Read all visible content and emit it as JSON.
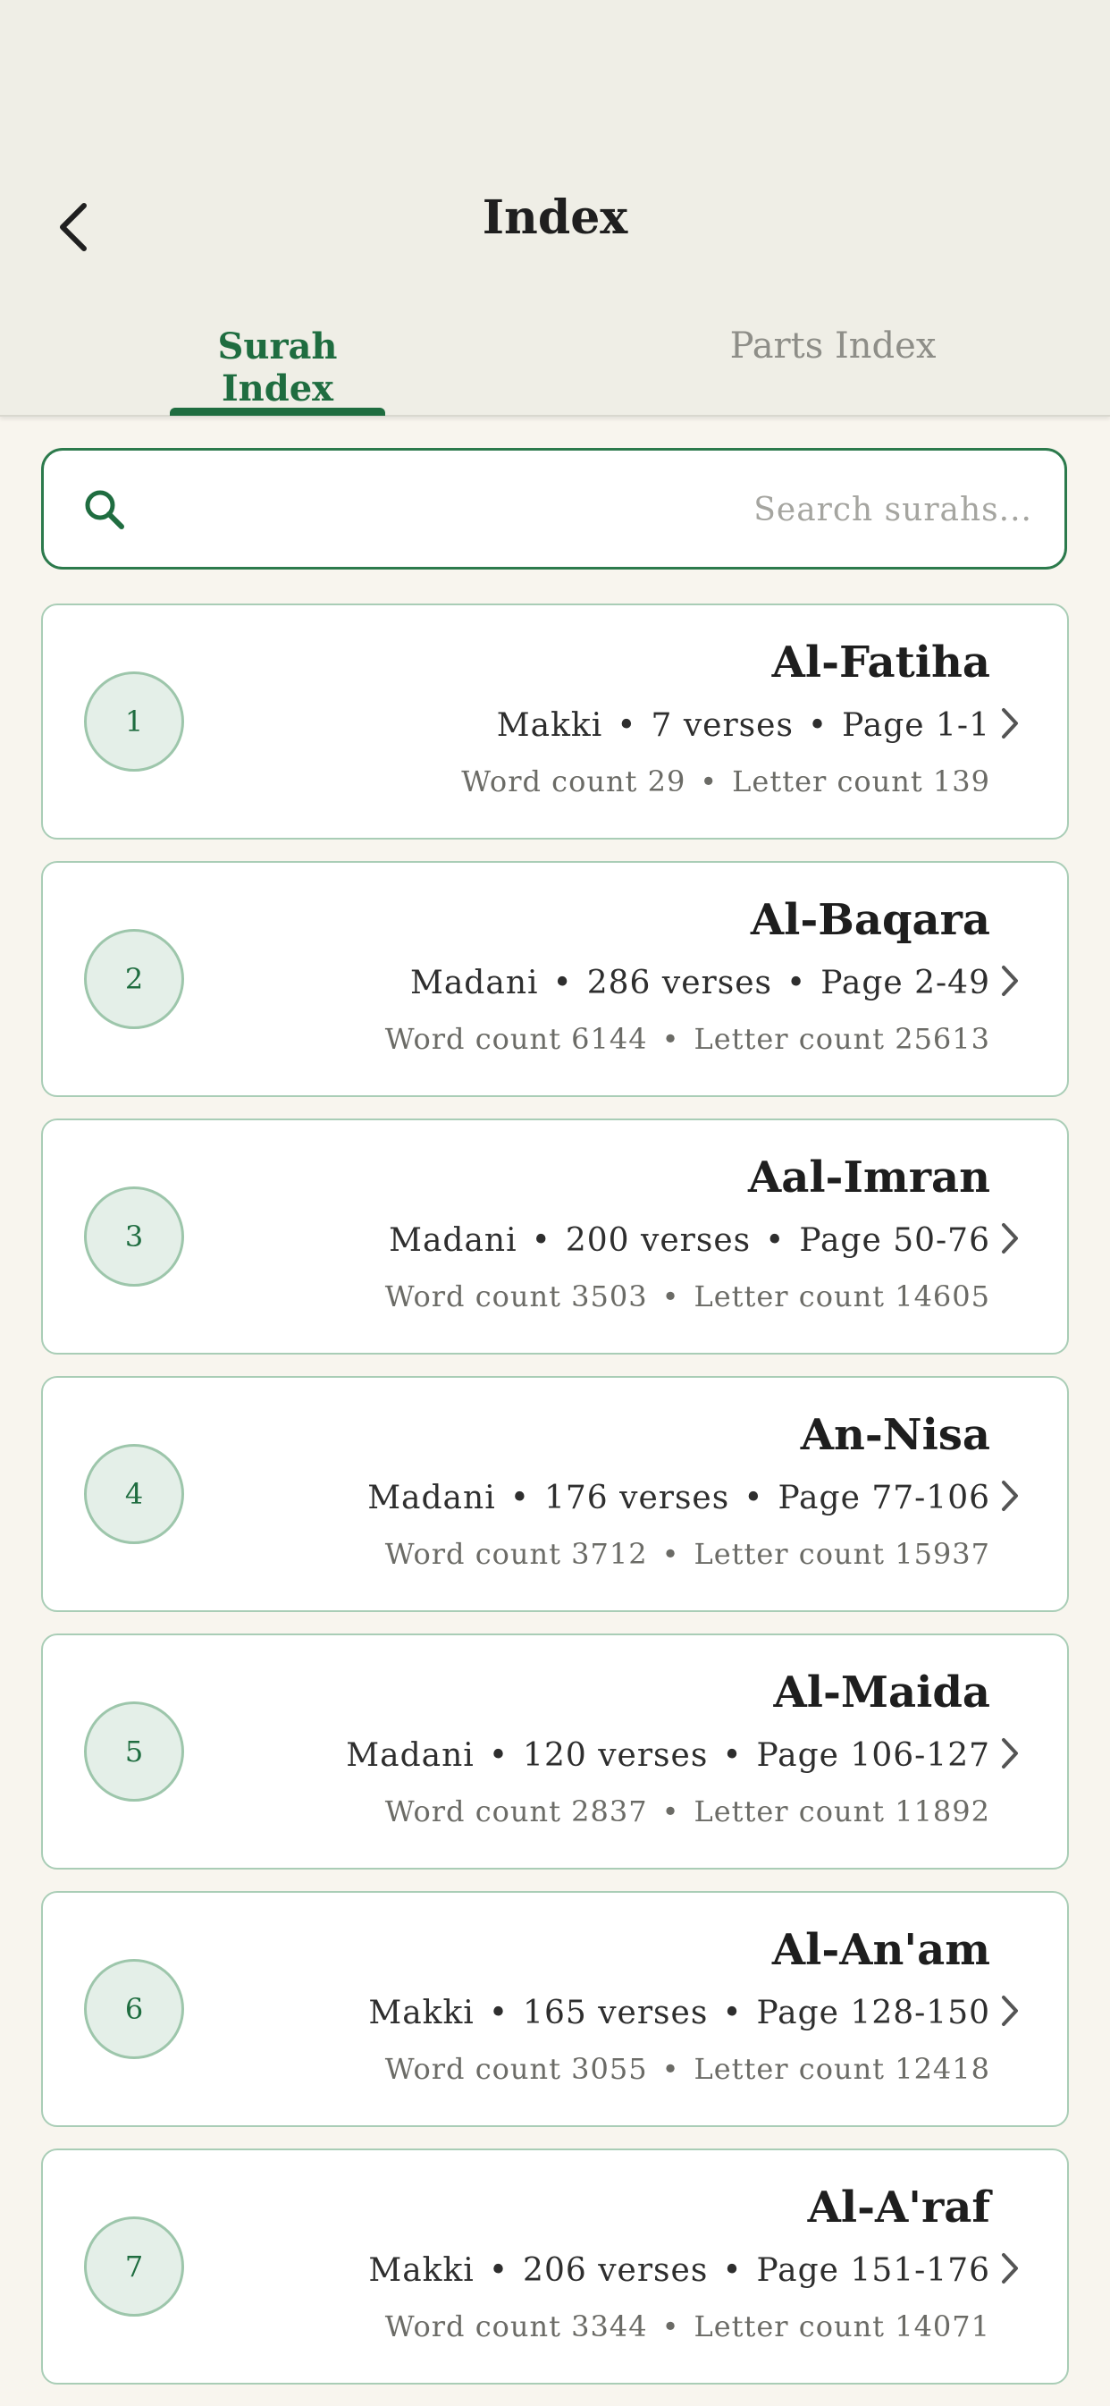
{
  "header": {
    "title": "Index",
    "tabs": {
      "surah": "Surah Index",
      "parts": "Parts Index"
    },
    "active_tab": "Surah Index"
  },
  "search": {
    "placeholder": "Search surahs..."
  },
  "colors": {
    "accent": "#1f6d40",
    "header_bg": "#efeee6",
    "page_bg": "#f8f5ee",
    "card_border": "#a9cdb6"
  },
  "surahs": [
    {
      "number": "1",
      "name": "Al-Fatiha",
      "type": "Makki",
      "verses": "7 verses",
      "pages": "Page 1-1",
      "words": "Word count 29",
      "letters": "Letter count 139"
    },
    {
      "number": "2",
      "name": "Al-Baqara",
      "type": "Madani",
      "verses": "286 verses",
      "pages": "Page 2-49",
      "words": "Word count 6144",
      "letters": "Letter count 25613"
    },
    {
      "number": "3",
      "name": "Aal-Imran",
      "type": "Madani",
      "verses": "200 verses",
      "pages": "Page 50-76",
      "words": "Word count 3503",
      "letters": "Letter count 14605"
    },
    {
      "number": "4",
      "name": "An-Nisa",
      "type": "Madani",
      "verses": "176 verses",
      "pages": "Page 77-106",
      "words": "Word count 3712",
      "letters": "Letter count 15937"
    },
    {
      "number": "5",
      "name": "Al-Maida",
      "type": "Madani",
      "verses": "120 verses",
      "pages": "Page 106-127",
      "words": "Word count 2837",
      "letters": "Letter count 11892"
    },
    {
      "number": "6",
      "name": "Al-An'am",
      "type": "Makki",
      "verses": "165 verses",
      "pages": "Page 128-150",
      "words": "Word count 3055",
      "letters": "Letter count 12418"
    },
    {
      "number": "7",
      "name": "Al-A'raf",
      "type": "Makki",
      "verses": "206 verses",
      "pages": "Page 151-176",
      "words": "Word count 3344",
      "letters": "Letter count 14071"
    }
  ],
  "separator": "•"
}
